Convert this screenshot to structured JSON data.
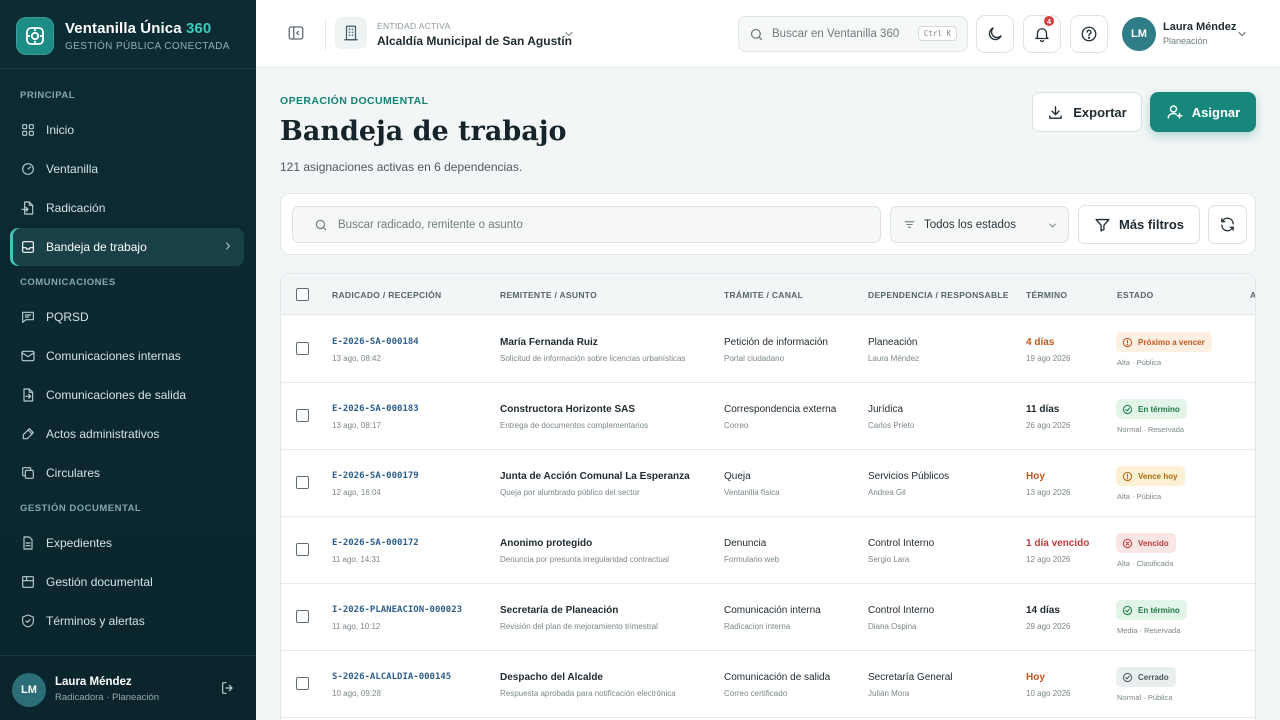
{
  "brand": {
    "title": "Ventanilla Única",
    "title_accent": "360",
    "subtitle": "GESTIÓN PÚBLICA CONECTADA"
  },
  "sidebar": {
    "sections": [
      {
        "title": "PRINCIPAL",
        "items": [
          {
            "label": "Inicio",
            "icon": "grid-icon"
          },
          {
            "label": "Ventanilla",
            "icon": "gauge-icon"
          },
          {
            "label": "Radicación",
            "icon": "file-import-icon"
          },
          {
            "label": "Bandeja de trabajo",
            "icon": "inbox-icon",
            "active": true
          }
        ]
      },
      {
        "title": "COMUNICACIONES",
        "items": [
          {
            "label": "PQRSD",
            "icon": "message-icon"
          },
          {
            "label": "Comunicaciones internas",
            "icon": "mail-icon"
          },
          {
            "label": "Comunicaciones de salida",
            "icon": "file-export-icon"
          },
          {
            "label": "Actos administrativos",
            "icon": "signature-icon"
          },
          {
            "label": "Circulares",
            "icon": "copy-icon"
          }
        ]
      },
      {
        "title": "GESTIÓN DOCUMENTAL",
        "items": [
          {
            "label": "Expedientes",
            "icon": "folder-icon"
          },
          {
            "label": "Gestión documental",
            "icon": "archive-icon"
          },
          {
            "label": "Términos y alertas",
            "icon": "shield-icon"
          }
        ]
      }
    ],
    "user": {
      "initials": "LM",
      "name": "Laura Méndez",
      "role": "Radicadora · Planeación"
    }
  },
  "topbar": {
    "entity_label": "ENTIDAD ACTIVA",
    "entity_name": "Alcaldía Municipal de San Agustín",
    "search_placeholder": "Buscar en Ventanilla 360",
    "search_shortcut": "Ctrl K",
    "notifications_count": "4",
    "user": {
      "initials": "LM",
      "name": "Laura Méndez",
      "role": "Planeación"
    }
  },
  "page": {
    "eyebrow": "OPERACIÓN DOCUMENTAL",
    "title": "Bandeja de trabajo",
    "subtitle": "121 asignaciones activas en 6 dependencias.",
    "export_label": "Exportar",
    "assign_label": "Asignar"
  },
  "filters": {
    "search_placeholder": "Buscar radicado, remitente o asunto",
    "status_selected": "Todos los estados",
    "more_filters_label": "Más filtros"
  },
  "table": {
    "headers": [
      "RADICADO / RECEPCIÓN",
      "REMITENTE / ASUNTO",
      "TRÁMITE / CANAL",
      "DEPENDENCIA / RESPONSABLE",
      "TÉRMINO",
      "ESTADO",
      "A"
    ],
    "rows": [
      {
        "id": "E-2026-SA-000184",
        "received": "13 ago, 08:42",
        "sender": "María Fernanda Ruiz",
        "subject": "Solicitud de información sobre licencias urbanísticas",
        "procedure": "Petición de información",
        "channel": "Portal ciudadano",
        "department": "Planeación",
        "owner": "Laura Méndez",
        "term": "4 días",
        "term_date": "19 ago 2026",
        "term_color": "#c4561a",
        "status": "Próximo a vencer",
        "status_kind": "warn",
        "status_icon": "alert-circle-icon",
        "status_sub": "Alta · Pública"
      },
      {
        "id": "E-2026-SA-000183",
        "received": "13 ago, 08:17",
        "sender": "Constructora Horizonte SAS",
        "subject": "Entrega de documentos complementarios",
        "procedure": "Correspondencia externa",
        "channel": "Correo",
        "department": "Jurídica",
        "owner": "Carlos Prieto",
        "term": "11 días",
        "term_date": "26 ago 2026",
        "term_color": "#1f2a30",
        "status": "En término",
        "status_kind": "ok",
        "status_icon": "check-circle-icon",
        "status_sub": "Normal · Reservada"
      },
      {
        "id": "E-2026-SA-000179",
        "received": "12 ago, 16:04",
        "sender": "Junta de Acción Comunal La Esperanza",
        "subject": "Queja por alumbrado público del sector",
        "procedure": "Queja",
        "channel": "Ventanilla física",
        "department": "Servicios Públicos",
        "owner": "Andrea Gil",
        "term": "Hoy",
        "term_date": "13 ago 2026",
        "term_color": "#c4561a",
        "status": "Vence hoy",
        "status_kind": "today",
        "status_icon": "alert-circle-icon",
        "status_sub": "Alta · Pública"
      },
      {
        "id": "E-2026-SA-000172",
        "received": "11 ago, 14:31",
        "sender": "Anonimo protegido",
        "subject": "Denuncia por presunta irregularidad contractual",
        "procedure": "Denuncia",
        "channel": "Formulario web",
        "department": "Control Interno",
        "owner": "Sergio Lara",
        "term": "1 día vencido",
        "term_date": "12 ago 2026",
        "term_color": "#c13b3b",
        "status": "Vencido",
        "status_kind": "late",
        "status_icon": "x-circle-icon",
        "status_sub": "Alta · Clasificada"
      },
      {
        "id": "I-2026-PLANEACION-000023",
        "received": "11 ago, 10:12",
        "sender": "Secretaría de Planeación",
        "subject": "Revisión del plan de mejoramiento trimestral",
        "procedure": "Comunicación interna",
        "channel": "Radicacion interna",
        "department": "Control Interno",
        "owner": "Diana Ospina",
        "term": "14 días",
        "term_date": "29 ago 2026",
        "term_color": "#1f2a30",
        "status": "En término",
        "status_kind": "ok",
        "status_icon": "check-circle-icon",
        "status_sub": "Media · Reservada"
      },
      {
        "id": "S-2026-ALCALDIA-000145",
        "received": "10 ago, 09:28",
        "sender": "Despacho del Alcalde",
        "subject": "Respuesta aprobada para notificación electrónica",
        "procedure": "Comunicación de salida",
        "channel": "Correo certificado",
        "department": "Secretaría General",
        "owner": "Julián Mora",
        "term": "Hoy",
        "term_date": "10 ago 2026",
        "term_color": "#c4561a",
        "status": "Cerrado",
        "status_kind": "closed",
        "status_icon": "check-circle-icon",
        "status_sub": "Normal · Pública"
      }
    ]
  }
}
